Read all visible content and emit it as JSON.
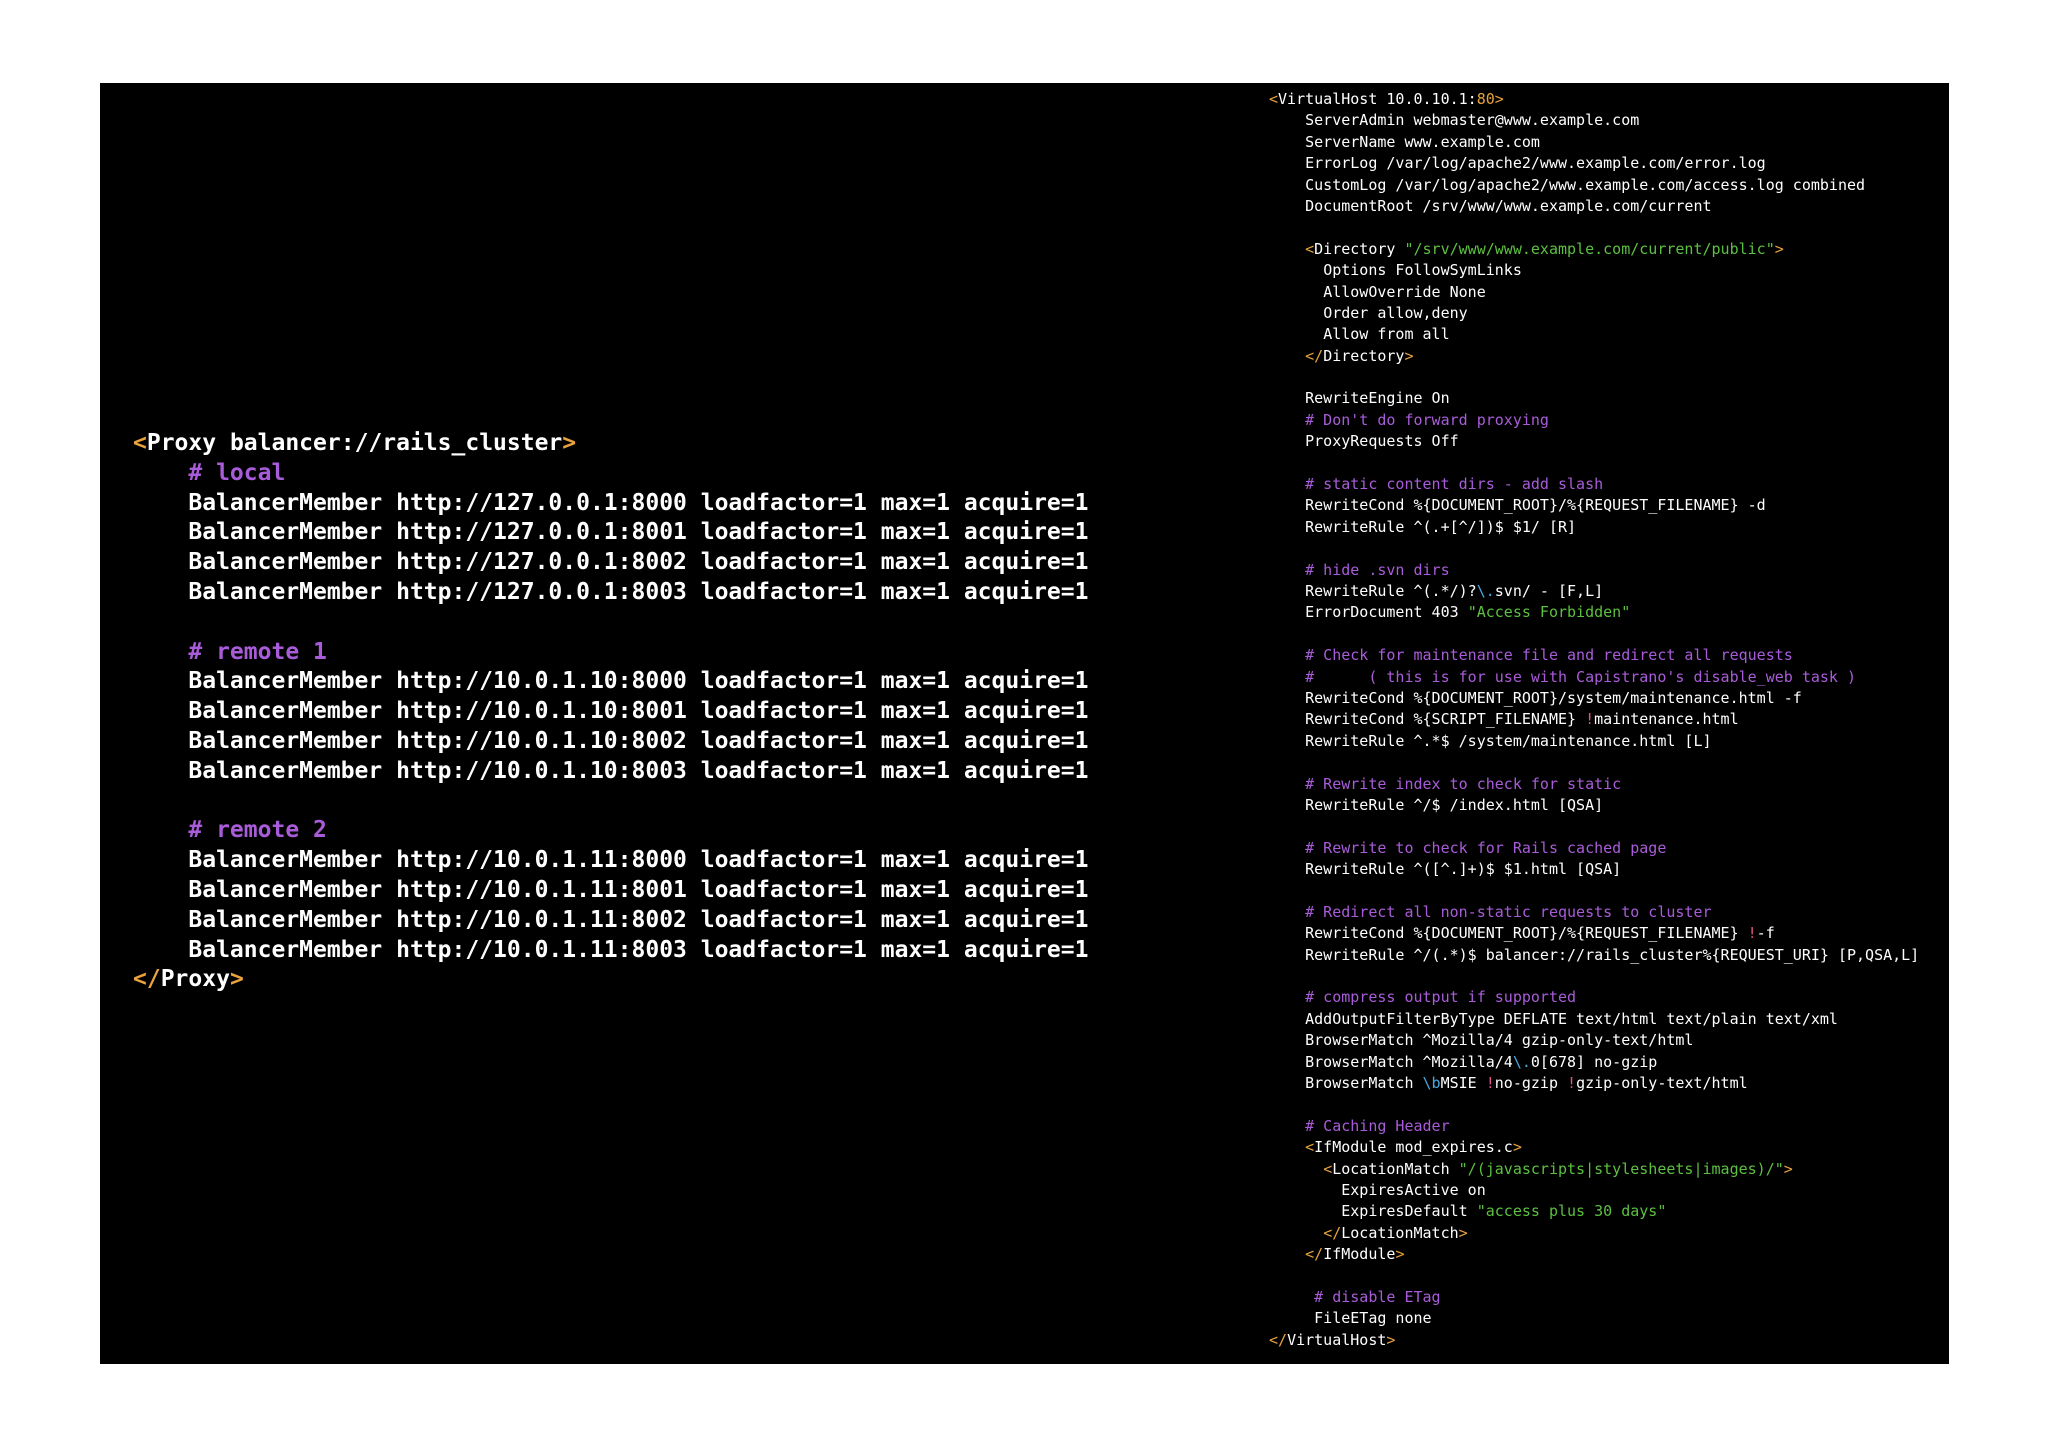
{
  "colors": {
    "background": "#000000",
    "page": "#ffffff",
    "text": "#ffffff",
    "bracket": "#e8a33c",
    "port": "#e8a33c",
    "comment": "#a95cd9",
    "string": "#5cc040",
    "regex": "#4aa8e0",
    "negation": "#e0508a"
  },
  "proxy_config": {
    "lines": [
      {
        "indent": "",
        "segments": [
          {
            "t": "<",
            "c": "bracket"
          },
          {
            "t": "Proxy balancer://rails_cluster",
            "c": "text"
          },
          {
            "t": ">",
            "c": "bracket"
          }
        ]
      },
      {
        "indent": "    ",
        "segments": [
          {
            "t": "# local",
            "c": "comment"
          }
        ]
      },
      {
        "indent": "    ",
        "segments": [
          {
            "t": "BalancerMember http://127.0.0.1:8000 loadfactor=1 max=1 acquire=1",
            "c": "text"
          }
        ]
      },
      {
        "indent": "    ",
        "segments": [
          {
            "t": "BalancerMember http://127.0.0.1:8001 loadfactor=1 max=1 acquire=1",
            "c": "text"
          }
        ]
      },
      {
        "indent": "    ",
        "segments": [
          {
            "t": "BalancerMember http://127.0.0.1:8002 loadfactor=1 max=1 acquire=1",
            "c": "text"
          }
        ]
      },
      {
        "indent": "    ",
        "segments": [
          {
            "t": "BalancerMember http://127.0.0.1:8003 loadfactor=1 max=1 acquire=1",
            "c": "text"
          }
        ]
      },
      {
        "indent": "",
        "segments": []
      },
      {
        "indent": "    ",
        "segments": [
          {
            "t": "# remote 1",
            "c": "comment"
          }
        ]
      },
      {
        "indent": "    ",
        "segments": [
          {
            "t": "BalancerMember http://10.0.1.10:8000 loadfactor=1 max=1 acquire=1",
            "c": "text"
          }
        ]
      },
      {
        "indent": "    ",
        "segments": [
          {
            "t": "BalancerMember http://10.0.1.10:8001 loadfactor=1 max=1 acquire=1",
            "c": "text"
          }
        ]
      },
      {
        "indent": "    ",
        "segments": [
          {
            "t": "BalancerMember http://10.0.1.10:8002 loadfactor=1 max=1 acquire=1",
            "c": "text"
          }
        ]
      },
      {
        "indent": "    ",
        "segments": [
          {
            "t": "BalancerMember http://10.0.1.10:8003 loadfactor=1 max=1 acquire=1",
            "c": "text"
          }
        ]
      },
      {
        "indent": "",
        "segments": []
      },
      {
        "indent": "    ",
        "segments": [
          {
            "t": "# remote 2",
            "c": "comment"
          }
        ]
      },
      {
        "indent": "    ",
        "segments": [
          {
            "t": "BalancerMember http://10.0.1.11:8000 loadfactor=1 max=1 acquire=1",
            "c": "text"
          }
        ]
      },
      {
        "indent": "    ",
        "segments": [
          {
            "t": "BalancerMember http://10.0.1.11:8001 loadfactor=1 max=1 acquire=1",
            "c": "text"
          }
        ]
      },
      {
        "indent": "    ",
        "segments": [
          {
            "t": "BalancerMember http://10.0.1.11:8002 loadfactor=1 max=1 acquire=1",
            "c": "text"
          }
        ]
      },
      {
        "indent": "    ",
        "segments": [
          {
            "t": "BalancerMember http://10.0.1.11:8003 loadfactor=1 max=1 acquire=1",
            "c": "text"
          }
        ]
      },
      {
        "indent": "",
        "segments": [
          {
            "t": "</",
            "c": "bracket"
          },
          {
            "t": "Proxy",
            "c": "text"
          },
          {
            "t": ">",
            "c": "bracket"
          }
        ]
      }
    ]
  },
  "vhost_config": {
    "lines": [
      {
        "indent": "",
        "segments": [
          {
            "t": "<",
            "c": "bracket"
          },
          {
            "t": "VirtualHost 10.0.10.1:",
            "c": "text"
          },
          {
            "t": "80",
            "c": "port"
          },
          {
            "t": ">",
            "c": "bracket"
          }
        ]
      },
      {
        "indent": "    ",
        "segments": [
          {
            "t": "ServerAdmin webmaster@www.example.com",
            "c": "text"
          }
        ]
      },
      {
        "indent": "    ",
        "segments": [
          {
            "t": "ServerName www.example.com",
            "c": "text"
          }
        ]
      },
      {
        "indent": "    ",
        "segments": [
          {
            "t": "ErrorLog /var/log/apache2/www.example.com/error.log",
            "c": "text"
          }
        ]
      },
      {
        "indent": "    ",
        "segments": [
          {
            "t": "CustomLog /var/log/apache2/www.example.com/access.log combined",
            "c": "text"
          }
        ]
      },
      {
        "indent": "    ",
        "segments": [
          {
            "t": "DocumentRoot /srv/www/www.example.com/current",
            "c": "text"
          }
        ]
      },
      {
        "indent": "",
        "segments": []
      },
      {
        "indent": "    ",
        "segments": [
          {
            "t": "<",
            "c": "bracket"
          },
          {
            "t": "Directory ",
            "c": "text"
          },
          {
            "t": "\"/srv/www/www.example.com/current/public\"",
            "c": "string"
          },
          {
            "t": ">",
            "c": "bracket"
          }
        ]
      },
      {
        "indent": "      ",
        "segments": [
          {
            "t": "Options FollowSymLinks",
            "c": "text"
          }
        ]
      },
      {
        "indent": "      ",
        "segments": [
          {
            "t": "AllowOverride None",
            "c": "text"
          }
        ]
      },
      {
        "indent": "      ",
        "segments": [
          {
            "t": "Order allow,deny",
            "c": "text"
          }
        ]
      },
      {
        "indent": "      ",
        "segments": [
          {
            "t": "Allow from all",
            "c": "text"
          }
        ]
      },
      {
        "indent": "    ",
        "segments": [
          {
            "t": "</",
            "c": "bracket"
          },
          {
            "t": "Directory",
            "c": "text"
          },
          {
            "t": ">",
            "c": "bracket"
          }
        ]
      },
      {
        "indent": "",
        "segments": []
      },
      {
        "indent": "    ",
        "segments": [
          {
            "t": "RewriteEngine On",
            "c": "text"
          }
        ]
      },
      {
        "indent": "    ",
        "segments": [
          {
            "t": "# Don't do forward proxying",
            "c": "comment"
          }
        ]
      },
      {
        "indent": "    ",
        "segments": [
          {
            "t": "ProxyRequests Off",
            "c": "text"
          }
        ]
      },
      {
        "indent": "",
        "segments": []
      },
      {
        "indent": "    ",
        "segments": [
          {
            "t": "# static content dirs - add slash",
            "c": "comment"
          }
        ]
      },
      {
        "indent": "    ",
        "segments": [
          {
            "t": "RewriteCond %{DOCUMENT_ROOT}/%{REQUEST_FILENAME} -d",
            "c": "text"
          }
        ]
      },
      {
        "indent": "    ",
        "segments": [
          {
            "t": "RewriteRule ^(.+[^/])$ $1/ [R]",
            "c": "text"
          }
        ]
      },
      {
        "indent": "",
        "segments": []
      },
      {
        "indent": "    ",
        "segments": [
          {
            "t": "# hide .svn dirs",
            "c": "comment"
          }
        ]
      },
      {
        "indent": "    ",
        "segments": [
          {
            "t": "RewriteRule ^(.*/)?",
            "c": "text"
          },
          {
            "t": "\\.",
            "c": "regex"
          },
          {
            "t": "svn/ - [F,L]",
            "c": "text"
          }
        ]
      },
      {
        "indent": "    ",
        "segments": [
          {
            "t": "ErrorDocument 403 ",
            "c": "text"
          },
          {
            "t": "\"Access Forbidden\"",
            "c": "string"
          }
        ]
      },
      {
        "indent": "",
        "segments": []
      },
      {
        "indent": "    ",
        "segments": [
          {
            "t": "# Check for maintenance file and redirect all requests",
            "c": "comment"
          }
        ]
      },
      {
        "indent": "    ",
        "segments": [
          {
            "t": "#      ( this is for use with Capistrano's disable_web task )",
            "c": "comment"
          }
        ]
      },
      {
        "indent": "    ",
        "segments": [
          {
            "t": "RewriteCond %{DOCUMENT_ROOT}/system/maintenance.html -f",
            "c": "text"
          }
        ]
      },
      {
        "indent": "    ",
        "segments": [
          {
            "t": "RewriteCond %{SCRIPT_FILENAME} ",
            "c": "text"
          },
          {
            "t": "!",
            "c": "negation"
          },
          {
            "t": "maintenance.html",
            "c": "text"
          }
        ]
      },
      {
        "indent": "    ",
        "segments": [
          {
            "t": "RewriteRule ^.*$ /system/maintenance.html [L]",
            "c": "text"
          }
        ]
      },
      {
        "indent": "",
        "segments": []
      },
      {
        "indent": "    ",
        "segments": [
          {
            "t": "# Rewrite index to check for static",
            "c": "comment"
          }
        ]
      },
      {
        "indent": "    ",
        "segments": [
          {
            "t": "RewriteRule ^/$ /index.html [QSA]",
            "c": "text"
          }
        ]
      },
      {
        "indent": "",
        "segments": []
      },
      {
        "indent": "    ",
        "segments": [
          {
            "t": "# Rewrite to check for Rails cached page",
            "c": "comment"
          }
        ]
      },
      {
        "indent": "    ",
        "segments": [
          {
            "t": "RewriteRule ^([^.]+)$ $1.html [QSA]",
            "c": "text"
          }
        ]
      },
      {
        "indent": "",
        "segments": []
      },
      {
        "indent": "    ",
        "segments": [
          {
            "t": "# Redirect all non-static requests to cluster",
            "c": "comment"
          }
        ]
      },
      {
        "indent": "    ",
        "segments": [
          {
            "t": "RewriteCond %{DOCUMENT_ROOT}/%{REQUEST_FILENAME} ",
            "c": "text"
          },
          {
            "t": "!",
            "c": "negation"
          },
          {
            "t": "-f",
            "c": "text"
          }
        ]
      },
      {
        "indent": "    ",
        "segments": [
          {
            "t": "RewriteRule ^/(.*)$ balancer://rails_cluster%{REQUEST_URI} [P,QSA,L]",
            "c": "text"
          }
        ]
      },
      {
        "indent": "",
        "segments": []
      },
      {
        "indent": "    ",
        "segments": [
          {
            "t": "# compress output if supported",
            "c": "comment"
          }
        ]
      },
      {
        "indent": "    ",
        "segments": [
          {
            "t": "AddOutputFilterByType DEFLATE text/html text/plain text/xml",
            "c": "text"
          }
        ]
      },
      {
        "indent": "    ",
        "segments": [
          {
            "t": "BrowserMatch ^Mozilla/4 gzip-only-text/html",
            "c": "text"
          }
        ]
      },
      {
        "indent": "    ",
        "segments": [
          {
            "t": "BrowserMatch ^Mozilla/4",
            "c": "text"
          },
          {
            "t": "\\.",
            "c": "regex"
          },
          {
            "t": "0[678] no-gzip",
            "c": "text"
          }
        ]
      },
      {
        "indent": "    ",
        "segments": [
          {
            "t": "BrowserMatch ",
            "c": "text"
          },
          {
            "t": "\\b",
            "c": "regex"
          },
          {
            "t": "MSIE ",
            "c": "text"
          },
          {
            "t": "!",
            "c": "negation"
          },
          {
            "t": "no-gzip ",
            "c": "text"
          },
          {
            "t": "!",
            "c": "negation"
          },
          {
            "t": "gzip-only-text/html",
            "c": "text"
          }
        ]
      },
      {
        "indent": "",
        "segments": []
      },
      {
        "indent": "    ",
        "segments": [
          {
            "t": "# Caching Header",
            "c": "comment"
          }
        ]
      },
      {
        "indent": "    ",
        "segments": [
          {
            "t": "<",
            "c": "bracket"
          },
          {
            "t": "IfModule mod_expires.c",
            "c": "text"
          },
          {
            "t": ">",
            "c": "bracket"
          }
        ]
      },
      {
        "indent": "      ",
        "segments": [
          {
            "t": "<",
            "c": "bracket"
          },
          {
            "t": "LocationMatch ",
            "c": "text"
          },
          {
            "t": "\"/(javascripts|stylesheets|images)/\"",
            "c": "string"
          },
          {
            "t": ">",
            "c": "bracket"
          }
        ]
      },
      {
        "indent": "        ",
        "segments": [
          {
            "t": "ExpiresActive on",
            "c": "text"
          }
        ]
      },
      {
        "indent": "        ",
        "segments": [
          {
            "t": "ExpiresDefault ",
            "c": "text"
          },
          {
            "t": "\"access plus 30 days\"",
            "c": "string"
          }
        ]
      },
      {
        "indent": "      ",
        "segments": [
          {
            "t": "</",
            "c": "bracket"
          },
          {
            "t": "LocationMatch",
            "c": "text"
          },
          {
            "t": ">",
            "c": "bracket"
          }
        ]
      },
      {
        "indent": "    ",
        "segments": [
          {
            "t": "</",
            "c": "bracket"
          },
          {
            "t": "IfModule",
            "c": "text"
          },
          {
            "t": ">",
            "c": "bracket"
          }
        ]
      },
      {
        "indent": "",
        "segments": []
      },
      {
        "indent": "     ",
        "segments": [
          {
            "t": "# disable ETag",
            "c": "comment"
          }
        ]
      },
      {
        "indent": "     ",
        "segments": [
          {
            "t": "FileETag none",
            "c": "text"
          }
        ]
      },
      {
        "indent": "",
        "segments": [
          {
            "t": "</",
            "c": "bracket"
          },
          {
            "t": "VirtualHost",
            "c": "text"
          },
          {
            "t": ">",
            "c": "bracket"
          }
        ]
      }
    ]
  }
}
